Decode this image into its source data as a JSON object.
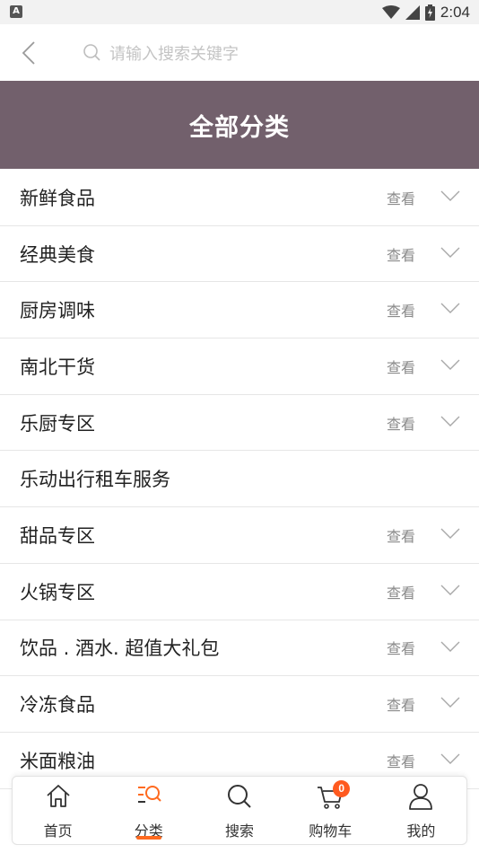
{
  "status_bar": {
    "notification_letter": "A",
    "time": "2:04"
  },
  "search": {
    "placeholder": "请输入搜索关键字"
  },
  "banner": {
    "title": "全部分类"
  },
  "categories": [
    {
      "name": "新鲜食品",
      "action": "查看"
    },
    {
      "name": "经典美食",
      "action": "查看"
    },
    {
      "name": "厨房调味",
      "action": "查看"
    },
    {
      "name": "南北干货",
      "action": "查看"
    },
    {
      "name": "乐厨专区",
      "action": "查看"
    },
    {
      "name": "乐动出行租车服务",
      "action": ""
    },
    {
      "name": "甜品专区",
      "action": "查看"
    },
    {
      "name": "火锅专区",
      "action": "查看"
    },
    {
      "name": "饮品 . 酒水. 超值大礼包",
      "action": "查看"
    },
    {
      "name": "冷冻食品",
      "action": "查看"
    },
    {
      "name": "米面粮油",
      "action": "查看"
    }
  ],
  "tabbar": {
    "items": [
      {
        "label": "首页",
        "icon": "home-icon"
      },
      {
        "label": "分类",
        "icon": "category-search-icon",
        "active": true
      },
      {
        "label": "搜索",
        "icon": "search-icon"
      },
      {
        "label": "购物车",
        "icon": "cart-icon",
        "badge": "0"
      },
      {
        "label": "我的",
        "icon": "user-icon"
      }
    ]
  },
  "colors": {
    "banner": "#72606c",
    "accent": "#ff6a1f",
    "badge": "#ff5a1f"
  }
}
